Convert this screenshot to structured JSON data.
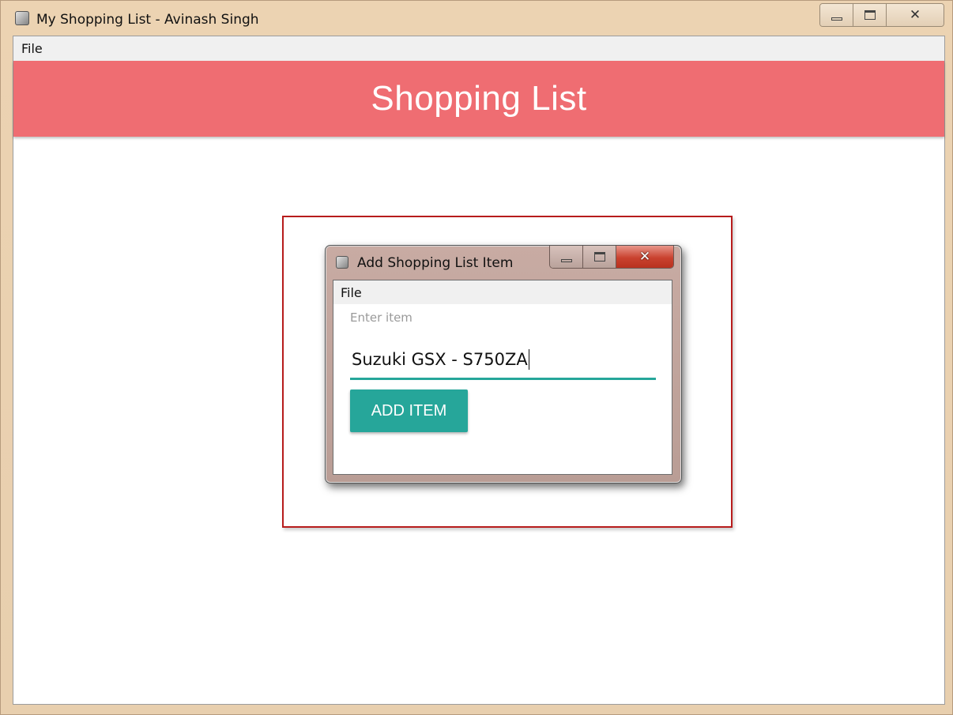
{
  "main_window": {
    "title": "My Shopping List - Avinash Singh",
    "menu": [
      "File"
    ],
    "header_title": "Shopping List"
  },
  "dialog": {
    "title": "Add Shopping List Item",
    "menu": [
      "File"
    ],
    "input_label": "Enter item",
    "input_value": "Suzuki GSX - S750ZA",
    "button_label": "ADD ITEM"
  },
  "colors": {
    "header": "#ef6d72",
    "accent": "#26a69a",
    "highlight_border": "#b71c1c"
  },
  "icons": {
    "app": "app-icon",
    "minimize": "minimize-icon",
    "maximize": "maximize-icon",
    "close": "close-icon"
  }
}
